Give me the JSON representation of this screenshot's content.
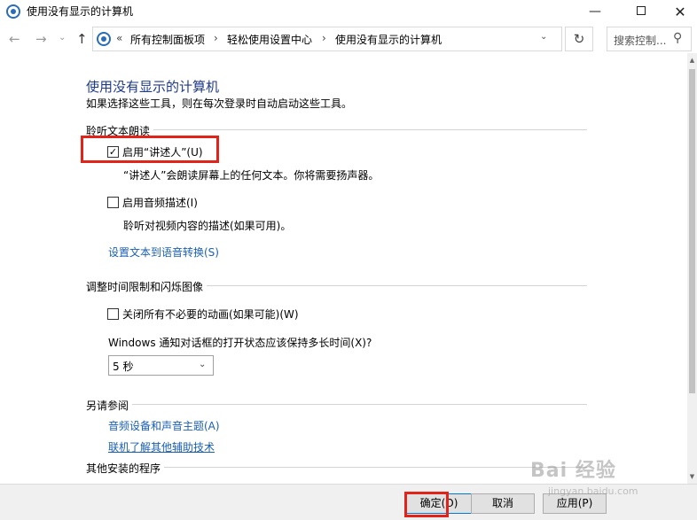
{
  "window": {
    "title": "使用没有显示的计算机",
    "minimize_glyph": "—",
    "close_glyph": "✕"
  },
  "nav": {
    "back_glyph": "←",
    "forward_glyph": "→",
    "recent_glyph": "⌄",
    "up_glyph": "↑",
    "crumb_prefix": "«",
    "breadcrumb": [
      "所有控制面板项",
      "轻松使用设置中心",
      "使用没有显示的计算机"
    ],
    "crumb_sep": "›",
    "dropdown_glyph": "⌄",
    "refresh_glyph": "↻",
    "search_placeholder": "搜索控制...",
    "search_glyph": "⚲"
  },
  "page": {
    "title": "使用没有显示的计算机",
    "subtitle": "如果选择这些工具，则在每次登录时自动启动这些工具。"
  },
  "sections": {
    "listen": {
      "heading": "聆听文本朗读",
      "narrator_label": "启用“讲述人”(U)",
      "narrator_checked": true,
      "narrator_desc": "“讲述人”会朗读屏幕上的任何文本。你将需要扬声器。",
      "audio_desc_label": "启用音频描述(I)",
      "audio_desc_checked": false,
      "audio_desc_desc": "聆听对视频内容的描述(如果可用)。",
      "tts_link": "设置文本到语音转换(S)"
    },
    "timing": {
      "heading": "调整时间限制和闪烁图像",
      "animations_label": "关闭所有不必要的动画(如果可能)(W)",
      "animations_checked": false,
      "notify_question": "Windows 通知对话框的打开状态应该保持多长时间(X)?",
      "notify_value": "5 秒"
    },
    "see_also": {
      "heading": "另请参阅",
      "link1": "音频设备和声音主题(A)",
      "link2": "联机了解其他辅助技术"
    },
    "other": {
      "heading": "其他安装的程序"
    }
  },
  "footer": {
    "ok": "确定(O)",
    "cancel": "取消",
    "apply": "应用(P)"
  },
  "icons": {
    "checkmark": "✓",
    "select_arrow": "⌄",
    "scroll_up": "▲",
    "scroll_down": "▼"
  },
  "watermark": {
    "text": "Bai 经验",
    "sub": "jingyan.baidu.com"
  },
  "colors": {
    "title_blue": "#1e3a8a",
    "link_blue": "#1a5fb4",
    "highlight_red": "#e2231a"
  }
}
